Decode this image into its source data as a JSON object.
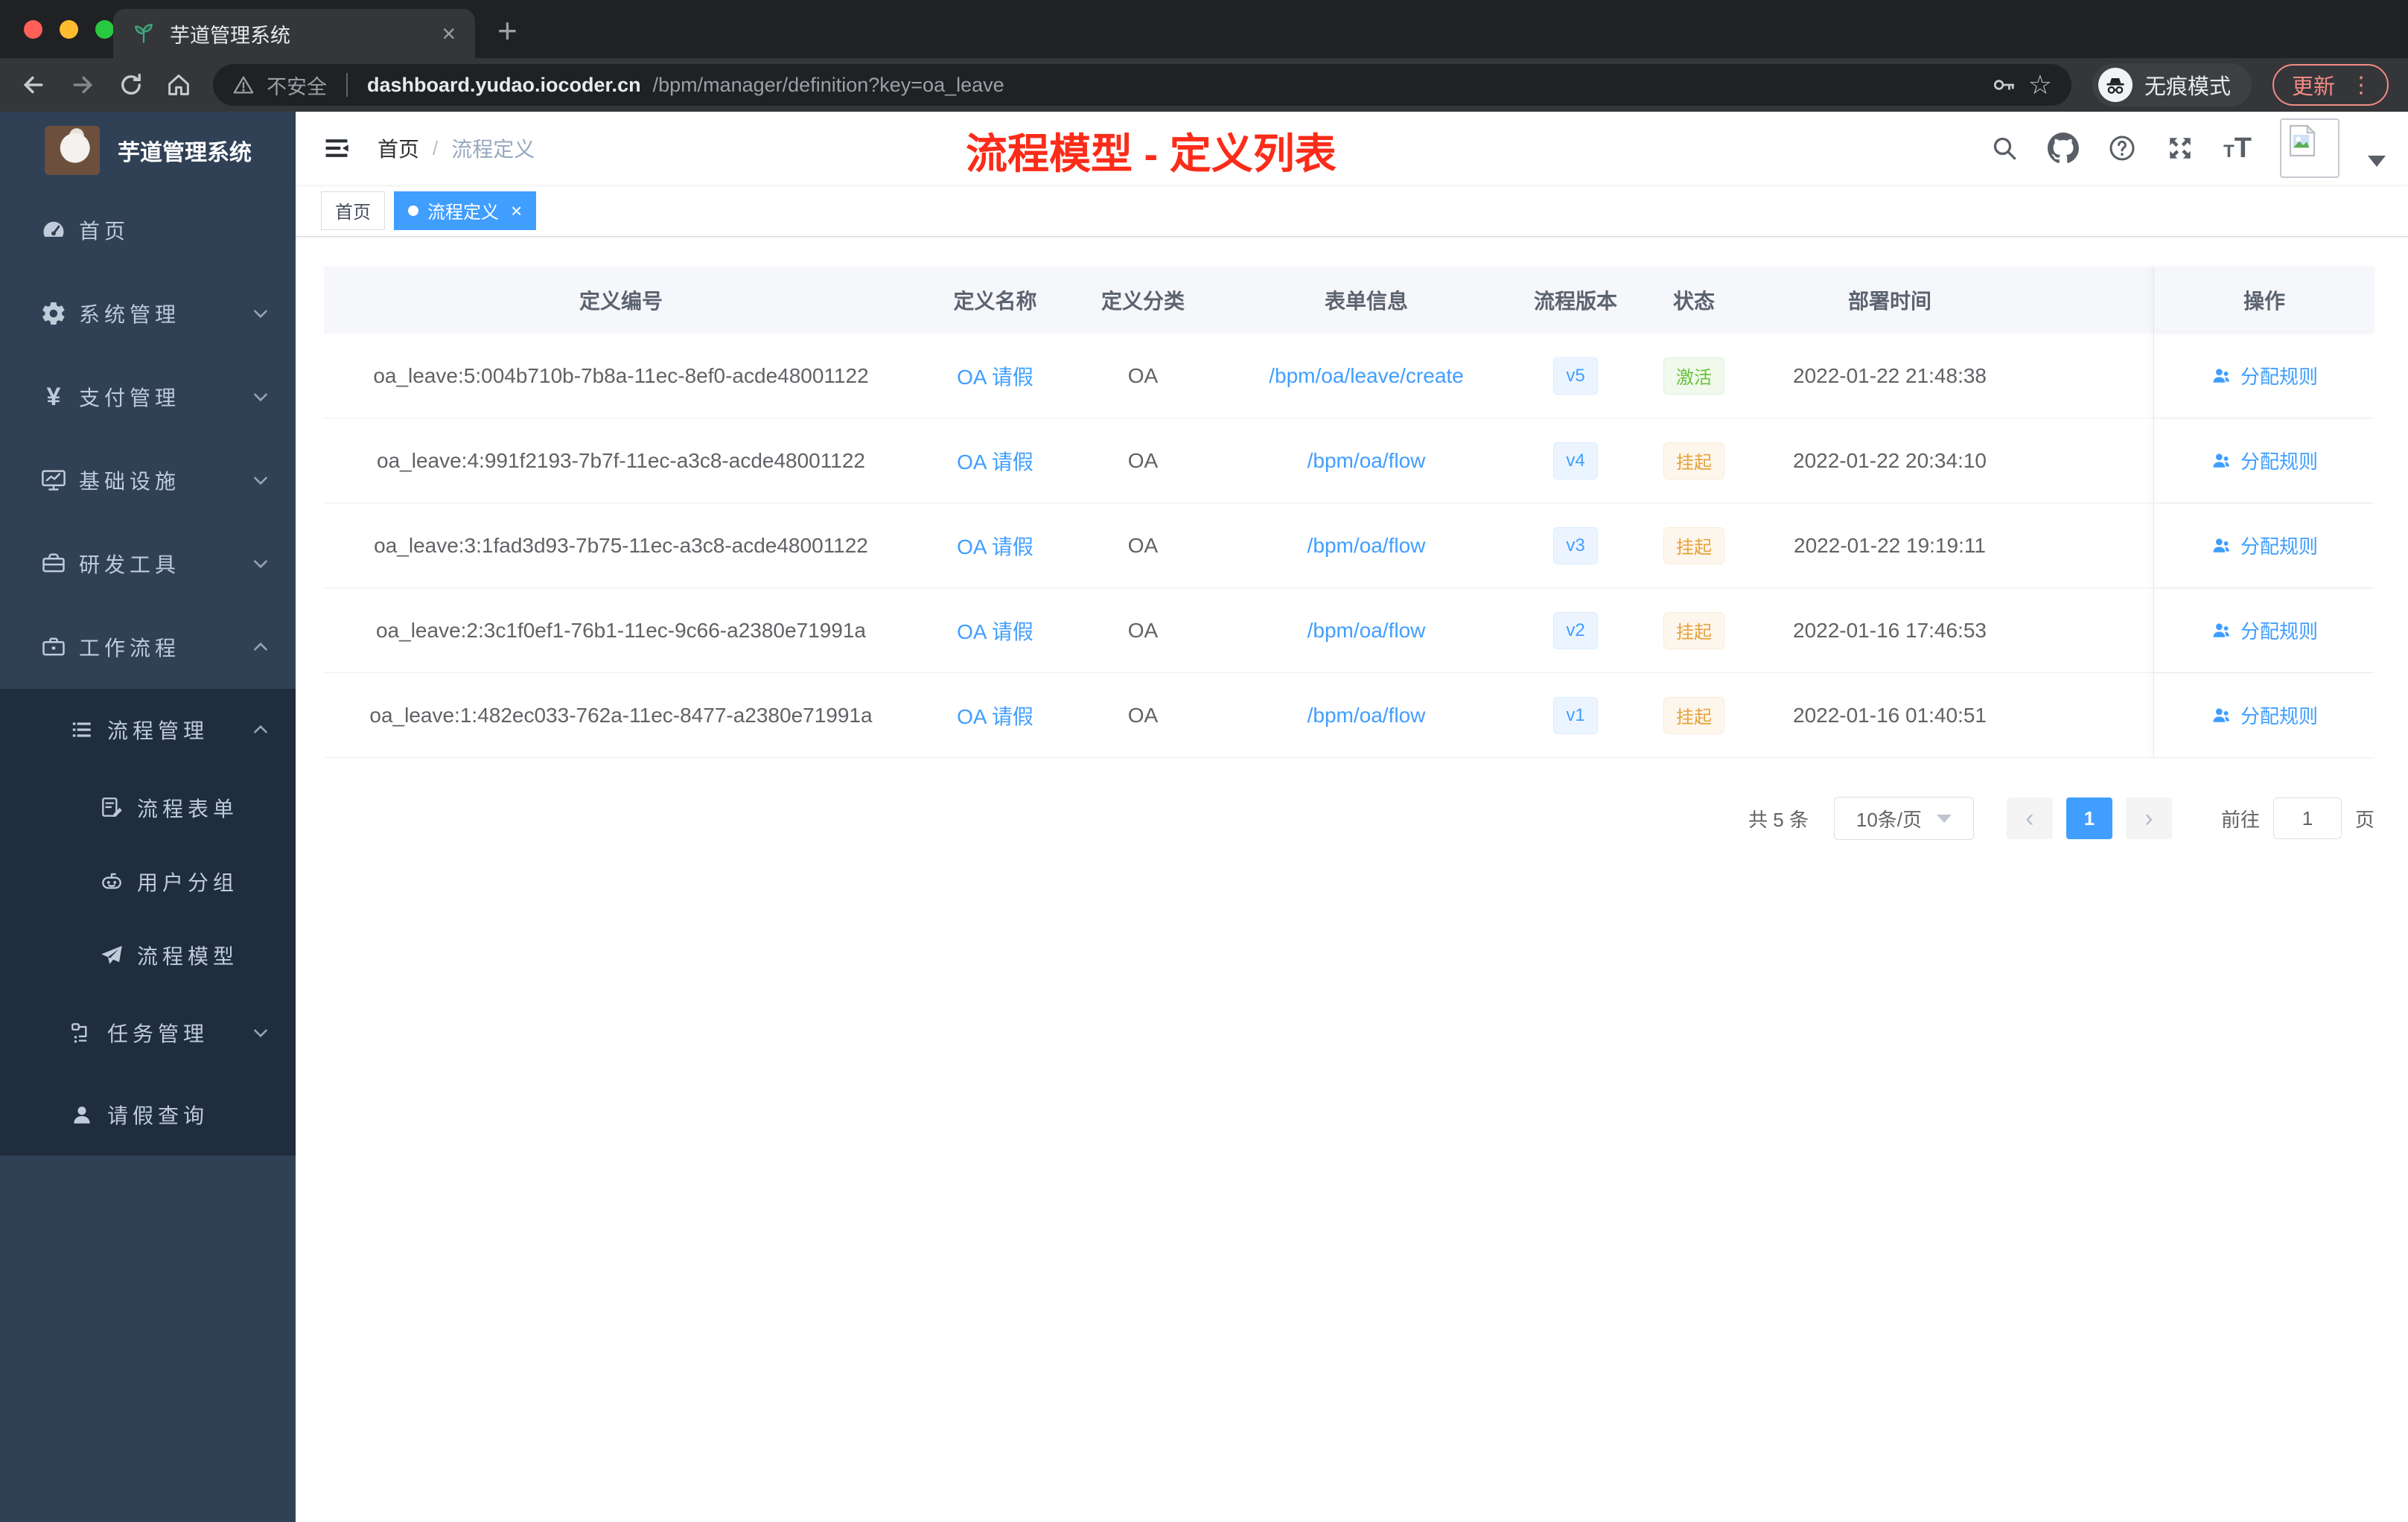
{
  "browser": {
    "tab_title": "芋道管理系统",
    "security_label": "不安全",
    "url_host": "dashboard.yudao.iocoder.cn",
    "url_path": "/bpm/manager/definition?key=oa_leave",
    "incognito_label": "无痕模式",
    "update_label": "更新"
  },
  "icons": {
    "close": "×",
    "plus": "+",
    "kebab": "⋮",
    "star": "☆",
    "yen": "¥",
    "home_glyph": "⌂",
    "chevron_left": "‹",
    "chevron_right": "›",
    "breadcrumb_separator": "/"
  },
  "sidebar": {
    "app_title": "芋道管理系统",
    "items": [
      {
        "label": "首页"
      },
      {
        "label": "系统管理"
      },
      {
        "label": "支付管理"
      },
      {
        "label": "基础设施"
      },
      {
        "label": "研发工具"
      },
      {
        "label": "工作流程"
      }
    ],
    "submenu": {
      "group_label": "流程管理",
      "children": [
        "流程表单",
        "用户分组",
        "流程模型"
      ],
      "siblings": [
        "任务管理",
        "请假查询"
      ]
    }
  },
  "header": {
    "breadcrumb": {
      "home": "首页",
      "current": "流程定义"
    },
    "annotation_title": "流程模型 - 定义列表"
  },
  "tags": [
    {
      "label": "首页"
    },
    {
      "label": "流程定义"
    }
  ],
  "table": {
    "columns": [
      "定义编号",
      "定义名称",
      "定义分类",
      "表单信息",
      "流程版本",
      "状态",
      "部署时间",
      "操作"
    ],
    "action_label": "分配规则",
    "rows": [
      {
        "id": "oa_leave:5:004b710b-7b8a-11ec-8ef0-acde48001122",
        "name": "OA 请假",
        "category": "OA",
        "form": "/bpm/oa/leave/create",
        "version": "v5",
        "status": "激活",
        "deploy_time": "2022-01-22 21:48:38"
      },
      {
        "id": "oa_leave:4:991f2193-7b7f-11ec-a3c8-acde48001122",
        "name": "OA 请假",
        "category": "OA",
        "form": "/bpm/oa/flow",
        "version": "v4",
        "status": "挂起",
        "deploy_time": "2022-01-22 20:34:10"
      },
      {
        "id": "oa_leave:3:1fad3d93-7b75-11ec-a3c8-acde48001122",
        "name": "OA 请假",
        "category": "OA",
        "form": "/bpm/oa/flow",
        "version": "v3",
        "status": "挂起",
        "deploy_time": "2022-01-22 19:19:11"
      },
      {
        "id": "oa_leave:2:3c1f0ef1-76b1-11ec-9c66-a2380e71991a",
        "name": "OA 请假",
        "category": "OA",
        "form": "/bpm/oa/flow",
        "version": "v2",
        "status": "挂起",
        "deploy_time": "2022-01-16 17:46:53"
      },
      {
        "id": "oa_leave:1:482ec033-762a-11ec-8477-a2380e71991a",
        "name": "OA 请假",
        "category": "OA",
        "form": "/bpm/oa/flow",
        "version": "v1",
        "status": "挂起",
        "deploy_time": "2022-01-16 01:40:51"
      }
    ]
  },
  "pagination": {
    "total_label": "共 5 条",
    "page_size": "10条/页",
    "current_page": "1",
    "goto_label": "前往",
    "goto_value": "1",
    "page_suffix": "页"
  },
  "colors": {
    "accent_blue": "#409eff",
    "success_green": "#67c23a",
    "warning_orange": "#e6a23c",
    "annotation_red": "#fb2c19",
    "sidebar_bg": "#304156",
    "submenu_bg": "#1f2d3d",
    "chrome_update_red": "#f28b82"
  }
}
